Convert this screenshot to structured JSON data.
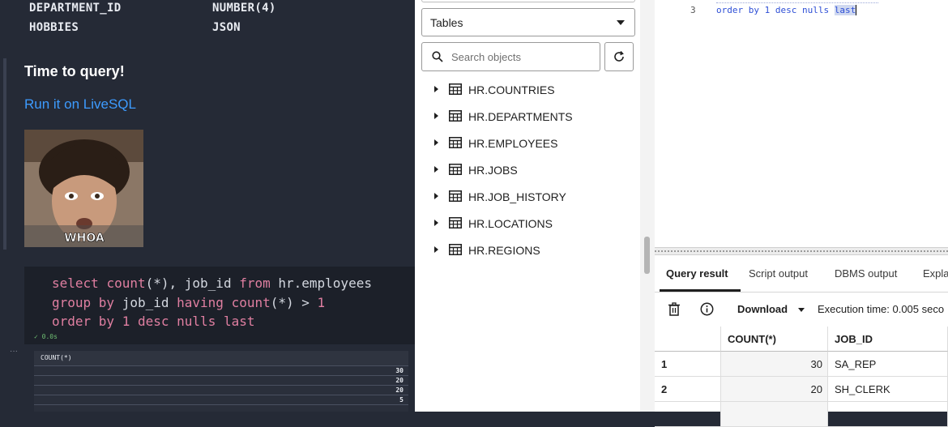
{
  "schema_rows": [
    {
      "column": "DEPARTMENT_ID",
      "type": "NUMBER(4)"
    },
    {
      "column": "HOBBIES",
      "type": "JSON"
    }
  ],
  "notebook": {
    "heading": "Time to query!",
    "link": "Run it on LiveSQL",
    "meme_caption": "WHOA",
    "code_lines": [
      "select count(*), job_id from hr.employees",
      "group by job_id having count(*) > 1",
      "order by 1 desc nulls last"
    ],
    "exec_status": "✓ 0.0s",
    "ellipsis": "···",
    "result_header": "COUNT(*)",
    "result_values": [
      "30",
      "20",
      "20",
      "5"
    ]
  },
  "browser": {
    "object_type": "Tables",
    "search_placeholder": "Search objects",
    "tables": [
      "HR.COUNTRIES",
      "HR.DEPARTMENTS",
      "HR.EMPLOYEES",
      "HR.JOBS",
      "HR.JOB_HISTORY",
      "HR.LOCATIONS",
      "HR.REGIONS"
    ]
  },
  "editor": {
    "line_number": "3",
    "code_before": "order by 1 desc nulls ",
    "code_selected": "last"
  },
  "results": {
    "tabs": [
      "Query result",
      "Script output",
      "DBMS output",
      "Expla"
    ],
    "download": "Download",
    "exec_time": "Execution time: 0.005 seco",
    "columns": [
      "COUNT(*)",
      "JOB_ID"
    ],
    "rows": [
      {
        "n": "1",
        "count": "30",
        "job": "SA_REP"
      },
      {
        "n": "2",
        "count": "20",
        "job": "SH_CLERK"
      }
    ]
  },
  "colors": {
    "link": "#3d9bff",
    "keyword": "#e07fa1",
    "editor_code": "#2e4fd6"
  }
}
